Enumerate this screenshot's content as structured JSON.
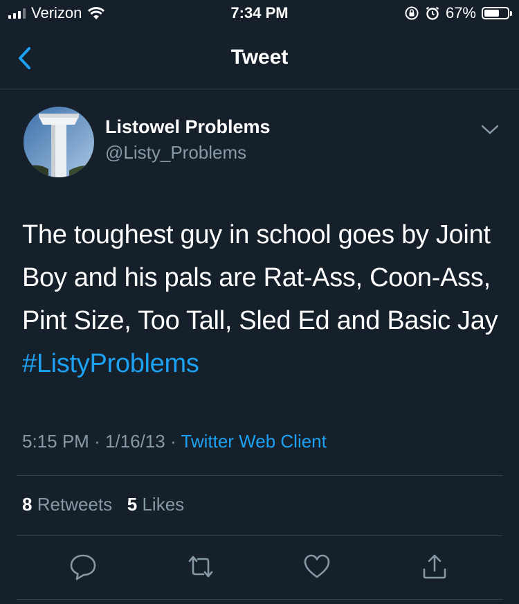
{
  "status_bar": {
    "carrier": "Verizon",
    "time": "7:34 PM",
    "battery_percent": "67%",
    "battery_level": 0.67
  },
  "nav": {
    "title": "Tweet"
  },
  "tweet": {
    "author_name": "Listowel Problems",
    "author_handle": "@Listy_Problems",
    "text": "The toughest guy in school goes by Joint Boy and his pals are Rat-Ass, Coon-Ass, Pint Size, Too Tall, Sled Ed and Basic Jay ",
    "hashtag": "#ListyProblems",
    "time": "5:15 PM",
    "date": "1/16/13",
    "separator": "·",
    "source": "Twitter Web Client",
    "retweet_count": "8",
    "retweet_label": "Retweets",
    "like_count": "5",
    "like_label": "Likes"
  },
  "actions": [
    "reply-icon",
    "retweet-icon",
    "like-icon",
    "share-icon"
  ],
  "colors": {
    "background": "#15202b",
    "accent": "#1da1f2",
    "secondary_text": "#8899a6",
    "divider": "#38444d"
  }
}
